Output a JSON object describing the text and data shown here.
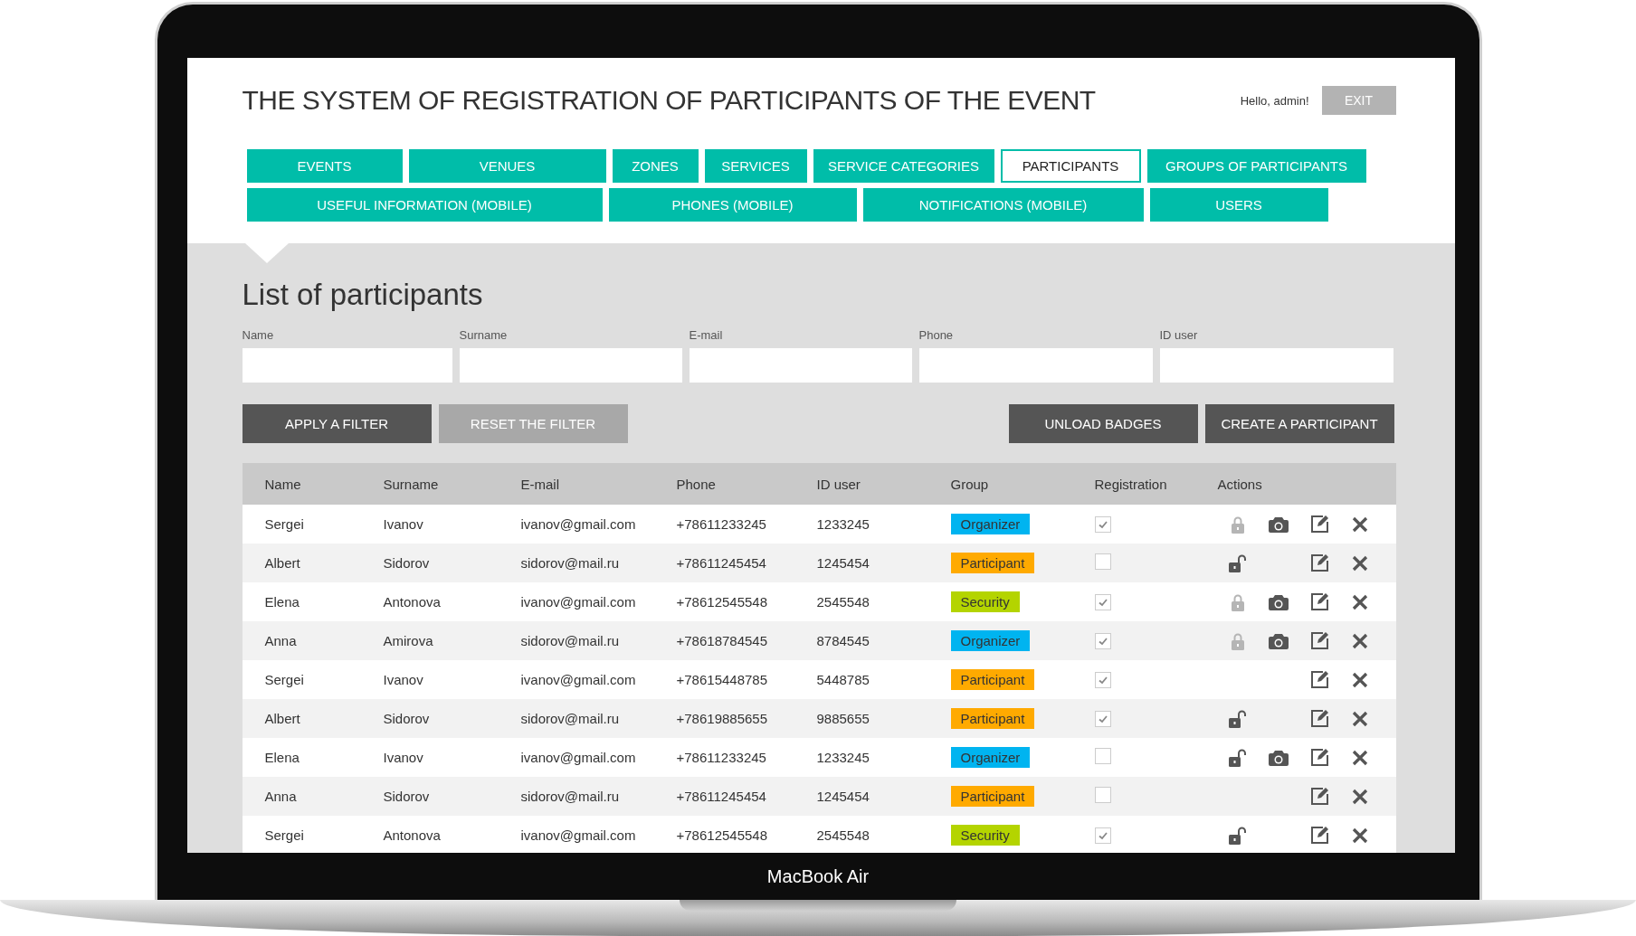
{
  "device_label": "MacBook Air",
  "header": {
    "title": "THE SYSTEM OF REGISTRATION OF PARTICIPANTS OF THE EVENT",
    "greeting": "Hello, admin!",
    "exit_button": "EXIT"
  },
  "nav_tabs": [
    {
      "label": "EVENTS",
      "selected": false
    },
    {
      "label": "VENUES",
      "selected": false
    },
    {
      "label": "ZONES",
      "selected": false
    },
    {
      "label": "SERVICES",
      "selected": false
    },
    {
      "label": "SERVICE CATEGORIES",
      "selected": false
    },
    {
      "label": "PARTICIPANTS",
      "selected": true
    },
    {
      "label": "GROUPS OF PARTICIPANTS",
      "selected": false
    },
    {
      "label": "USEFUL INFORMATION (MOBILE)",
      "selected": false
    },
    {
      "label": "PHONES (MOBILE)",
      "selected": false
    },
    {
      "label": "NOTIFICATIONS (MOBILE)",
      "selected": false
    },
    {
      "label": "USERS",
      "selected": false
    }
  ],
  "page_title": "List of participants",
  "filters": [
    {
      "label": "Name"
    },
    {
      "label": "Surname"
    },
    {
      "label": "E-mail"
    },
    {
      "label": "Phone"
    },
    {
      "label": "ID user"
    }
  ],
  "buttons": [
    {
      "label": "APPLY A FILTER",
      "kind": "dark"
    },
    {
      "label": "RESET THE FILTER",
      "kind": "light"
    },
    {
      "label": "UNLOAD BADGES",
      "kind": "dark"
    },
    {
      "label": "CREATE A PARTICIPANT",
      "kind": "dark"
    }
  ],
  "table": {
    "columns": [
      "Name",
      "Surname",
      "E-mail",
      "Phone",
      "ID user",
      "Group",
      "Registration",
      "Actions"
    ],
    "rows": [
      {
        "name": "Sergei",
        "surname": "Ivanov",
        "email": "ivanov@gmail.com",
        "phone": "+78611233245",
        "id": "1233245",
        "group": "Organizer",
        "color": "#00b4f0",
        "registered": true,
        "lock": {
          "locked": true
        },
        "camera": true
      },
      {
        "name": "Albert",
        "surname": "Sidorov",
        "email": "sidorov@mail.ru",
        "phone": "+78611245454",
        "id": "1245454",
        "group": "Participant",
        "color": "#ffaa00",
        "registered": false,
        "lock": {
          "locked": false
        },
        "camera": false
      },
      {
        "name": "Elena",
        "surname": "Antonova",
        "email": "ivanov@gmail.com",
        "phone": "+78612545548",
        "id": "2545548",
        "group": "Security",
        "color": "#b4d400",
        "registered": true,
        "lock": {
          "locked": true
        },
        "camera": true
      },
      {
        "name": "Anna",
        "surname": "Amirova",
        "email": "sidorov@mail.ru",
        "phone": "+78618784545",
        "id": "8784545",
        "group": "Organizer",
        "color": "#00b4f0",
        "registered": true,
        "lock": {
          "locked": true
        },
        "camera": true
      },
      {
        "name": "Sergei",
        "surname": "Ivanov",
        "email": "ivanov@gmail.com",
        "phone": "+78615448785",
        "id": "5448785",
        "group": "Participant",
        "color": "#ffaa00",
        "registered": true,
        "camera": false
      },
      {
        "name": "Albert",
        "surname": "Sidorov",
        "email": "sidorov@mail.ru",
        "phone": "+78619885655",
        "id": "9885655",
        "group": "Participant",
        "color": "#ffaa00",
        "registered": true,
        "lock": {
          "locked": false
        },
        "camera": false
      },
      {
        "name": "Elena",
        "surname": "Ivanov",
        "email": "ivanov@gmail.com",
        "phone": "+78611233245",
        "id": "1233245",
        "group": "Organizer",
        "color": "#00b4f0",
        "registered": false,
        "lock": {
          "locked": false
        },
        "camera": true
      },
      {
        "name": "Anna",
        "surname": "Sidorov",
        "email": "sidorov@mail.ru",
        "phone": "+78611245454",
        "id": "1245454",
        "group": "Participant",
        "color": "#ffaa00",
        "registered": false,
        "camera": false
      },
      {
        "name": "Sergei",
        "surname": "Antonova",
        "email": "ivanov@gmail.com",
        "phone": "+78612545548",
        "id": "2545548",
        "group": "Security",
        "color": "#b4d400",
        "registered": true,
        "lock": {
          "locked": false
        },
        "camera": false
      }
    ]
  }
}
